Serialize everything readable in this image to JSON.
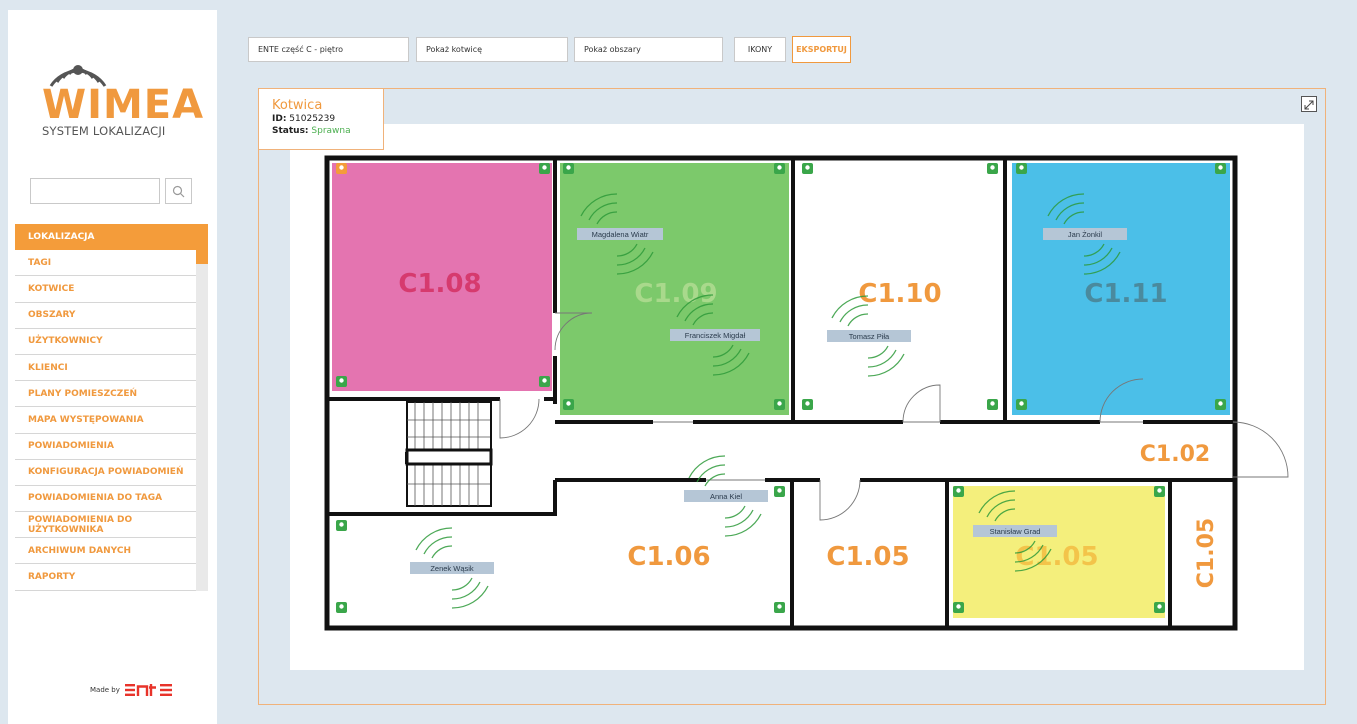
{
  "brand": {
    "logo_text": "WIMEA",
    "subtitle": "SYSTEM LOKALIZACJI",
    "made_by_label": "Made by",
    "vendor_logo_text": "ENTE"
  },
  "search": {
    "placeholder": "",
    "value": ""
  },
  "menu": {
    "items": [
      {
        "label": "LOKALIZACJA",
        "active": true
      },
      {
        "label": "TAGI",
        "active": false
      },
      {
        "label": "KOTWICE",
        "active": false
      },
      {
        "label": "OBSZARY",
        "active": false
      },
      {
        "label": "UŻYTKOWNICY",
        "active": false
      },
      {
        "label": "KLIENCI",
        "active": false
      },
      {
        "label": "PLANY POMIESZCZEŃ",
        "active": false
      },
      {
        "label": "MAPA WYSTĘPOWANIA",
        "active": false
      },
      {
        "label": "POWIADOMIENIA",
        "active": false
      },
      {
        "label": "KONFIGURACJA POWIADOMIEŃ",
        "active": false
      },
      {
        "label": "POWIADOMIENIA DO TAGA",
        "active": false
      },
      {
        "label": "POWIADOMIENIA DO UŻYTKOWNIKA",
        "active": false
      },
      {
        "label": "ARCHIWUM DANYCH",
        "active": false
      },
      {
        "label": "RAPORTY",
        "active": false
      }
    ]
  },
  "toolbar": {
    "plan_select": "ENTE część C - piętro",
    "anchor_select": "Pokaż kotwicę",
    "areas_select": "Pokaż obszary",
    "icons_button": "IKONY",
    "export_button": "EKSPORTUJ"
  },
  "anchor_info": {
    "title": "Kotwica",
    "id_label": "ID:",
    "id_value": "51025239",
    "status_label": "Status:",
    "status_value": "Sprawna"
  },
  "colors": {
    "accent": "#f0993e",
    "room_pink": "#e474b0",
    "room_green": "#7cc96b",
    "room_blue": "#4bbfe8",
    "room_yellow": "#f4ef7c",
    "anchor_green": "#3aa64a",
    "status_ok": "#4caf50"
  },
  "rooms": [
    {
      "label": "C1.08",
      "color": "#d63a6e"
    },
    {
      "label": "C1.09",
      "color": "#a9d98c"
    },
    {
      "label": "C1.10",
      "color": "#f0993e"
    },
    {
      "label": "C1.11",
      "color": "#4a8a9e"
    },
    {
      "label": "C1.02",
      "color": "#f0993e"
    },
    {
      "label": "C1.06",
      "color": "#f0993e"
    },
    {
      "label": "C1.05",
      "color": "#f0993e"
    },
    {
      "label": "C1.05",
      "color": "#f3c44a"
    },
    {
      "label": "C1.05",
      "color": "#f0993e"
    }
  ],
  "tags": [
    {
      "name": "Magdalena Wiatr"
    },
    {
      "name": "Franciszek Migdał"
    },
    {
      "name": "Tomasz Piła"
    },
    {
      "name": "Jan Żonkil"
    },
    {
      "name": "Anna Kiel"
    },
    {
      "name": "Stanisław Grad"
    },
    {
      "name": "Zenek Wąsik"
    }
  ]
}
